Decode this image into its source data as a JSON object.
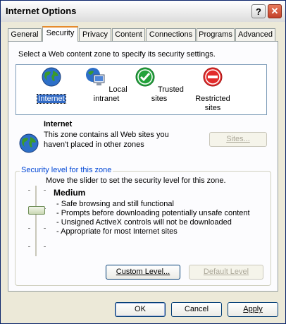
{
  "window": {
    "title": "Internet Options",
    "help_label": "?",
    "close_label": "✕"
  },
  "tabs": [
    {
      "label": "General"
    },
    {
      "label": "Security"
    },
    {
      "label": "Privacy"
    },
    {
      "label": "Content"
    },
    {
      "label": "Connections"
    },
    {
      "label": "Programs"
    },
    {
      "label": "Advanced"
    }
  ],
  "security": {
    "instruction": "Select a Web content zone to specify its security settings.",
    "zones": [
      {
        "label": "Internet",
        "icon": "globe-icon"
      },
      {
        "label": "Local intranet",
        "icon": "intranet-icon"
      },
      {
        "label": "Trusted sites",
        "icon": "checkmark-icon"
      },
      {
        "label": "Restricted",
        "label2": "sites",
        "icon": "restricted-icon"
      }
    ],
    "selected_zone": {
      "name": "Internet",
      "desc_line1": "This zone contains all Web sites you",
      "desc_line2": "haven't placed in other zones"
    },
    "sites_button": "Sites...",
    "level_group_label": "Security level for this zone",
    "slider_instruction": "Move the slider to set the security level for this zone.",
    "level_name": "Medium",
    "level_points": [
      "- Safe browsing and still functional",
      "- Prompts before downloading potentially unsafe content",
      "- Unsigned ActiveX controls will not be downloaded",
      "- Appropriate for most Internet sites"
    ],
    "custom_level_button": "Custom Level...",
    "default_level_button": "Default Level"
  },
  "footer": {
    "ok": "OK",
    "cancel": "Cancel",
    "apply": "Apply"
  }
}
